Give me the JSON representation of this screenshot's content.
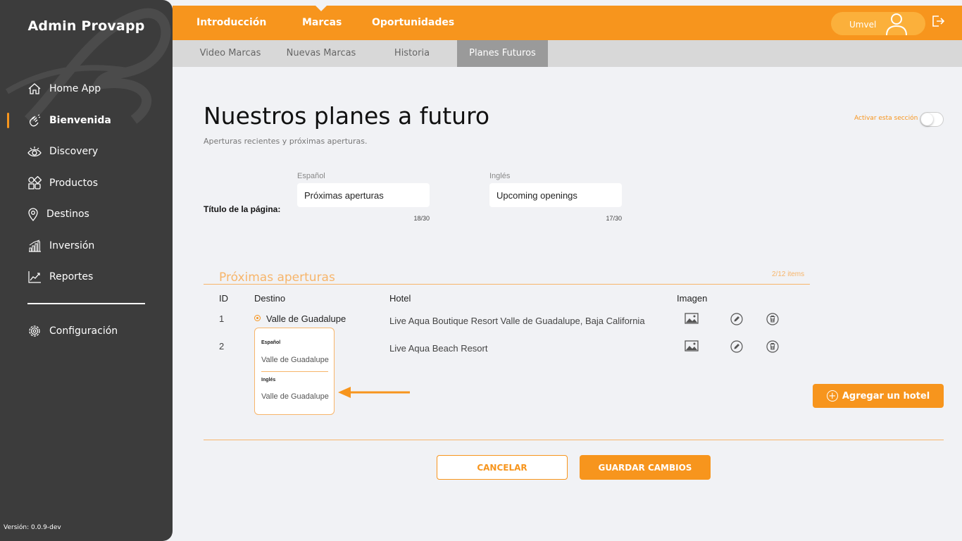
{
  "sidebar": {
    "brand": "Admin Provapp",
    "items": [
      {
        "label": "Home App",
        "icon": "home-icon"
      },
      {
        "label": "Bienvenida",
        "icon": "waving-hand-icon",
        "active": true
      },
      {
        "label": "Discovery",
        "icon": "eye-icon"
      },
      {
        "label": "Productos",
        "icon": "grid-shapes-icon"
      },
      {
        "label": "Destinos",
        "icon": "location-pin-icon"
      },
      {
        "label": "Inversión",
        "icon": "bar-chart-icon"
      },
      {
        "label": "Reportes",
        "icon": "line-chart-icon"
      }
    ],
    "config": {
      "label": "Configuración",
      "icon": "gear-icon"
    },
    "version": "Versión: 0.0.9-dev"
  },
  "topbar": {
    "tabs": [
      "Introducción",
      "Marcas",
      "Oportunidades"
    ],
    "active_tab": "Marcas",
    "user_name": "Umvel"
  },
  "subtabs": {
    "items": [
      "Video Marcas",
      "Nuevas Marcas",
      "Historia",
      "Planes Futuros"
    ],
    "active": "Planes Futuros"
  },
  "page": {
    "title": "Nuestros planes a futuro",
    "subtitle": "Aperturas recientes y próximas aperturas.",
    "toggle_label": "Activar esta sección",
    "toggle_on": false
  },
  "title_field": {
    "row_label": "Título de la página:",
    "es": {
      "label": "Español",
      "value": "Próximas aperturas",
      "counter": "18/30"
    },
    "en": {
      "label": "Inglés",
      "value": "Upcoming openings",
      "counter": "17/30"
    }
  },
  "section": {
    "title": "Próximas aperturas",
    "count": "2/12 items",
    "headers": {
      "id": "ID",
      "destino": "Destino",
      "hotel": "Hotel",
      "imagen": "Imagen"
    },
    "rows": [
      {
        "id": "1",
        "destino": "Valle de Guadalupe",
        "hotel": "Live Aqua Boutique Resort Valle de Guadalupe, Baja California"
      },
      {
        "id": "2",
        "destino": "",
        "hotel": "Live Aqua Beach Resort"
      }
    ],
    "popover": {
      "es_label": "Español",
      "es_value": "Valle de Guadalupe",
      "en_label": "Inglés",
      "en_value": "Valle de Guadalupe"
    },
    "add_button": "Agregar un hotel"
  },
  "actions": {
    "cancel": "CANCELAR",
    "save": "GUARDAR CAMBIOS"
  },
  "colors": {
    "accent": "#f7951d",
    "sidebar_bg": "#3c3c3c",
    "background": "#f1f2f5"
  }
}
